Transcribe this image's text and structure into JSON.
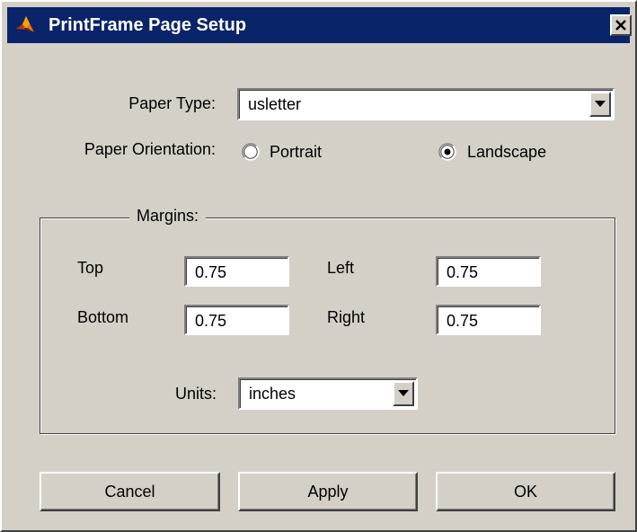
{
  "window": {
    "title": "PrintFrame Page Setup",
    "app_icon": "matlab-membrane-icon",
    "close_icon": "close-icon"
  },
  "paper": {
    "type_label": "Paper Type:",
    "type_value": "usletter",
    "orientation_label": "Paper Orientation:",
    "orientation_options": [
      {
        "label": "Portrait",
        "selected": false
      },
      {
        "label": "Landscape",
        "selected": true
      }
    ]
  },
  "margins": {
    "group_title": "Margins:",
    "top_label": "Top",
    "top_value": "0.75",
    "left_label": "Left",
    "left_value": "0.75",
    "bottom_label": "Bottom",
    "bottom_value": "0.75",
    "right_label": "Right",
    "right_value": "0.75",
    "units_label": "Units:",
    "units_value": "inches"
  },
  "buttons": {
    "cancel": "Cancel",
    "apply": "Apply",
    "ok": "OK"
  },
  "colors": {
    "face": "#d4d0c8",
    "titlebar": "#0a246a",
    "field": "#ffffff"
  }
}
